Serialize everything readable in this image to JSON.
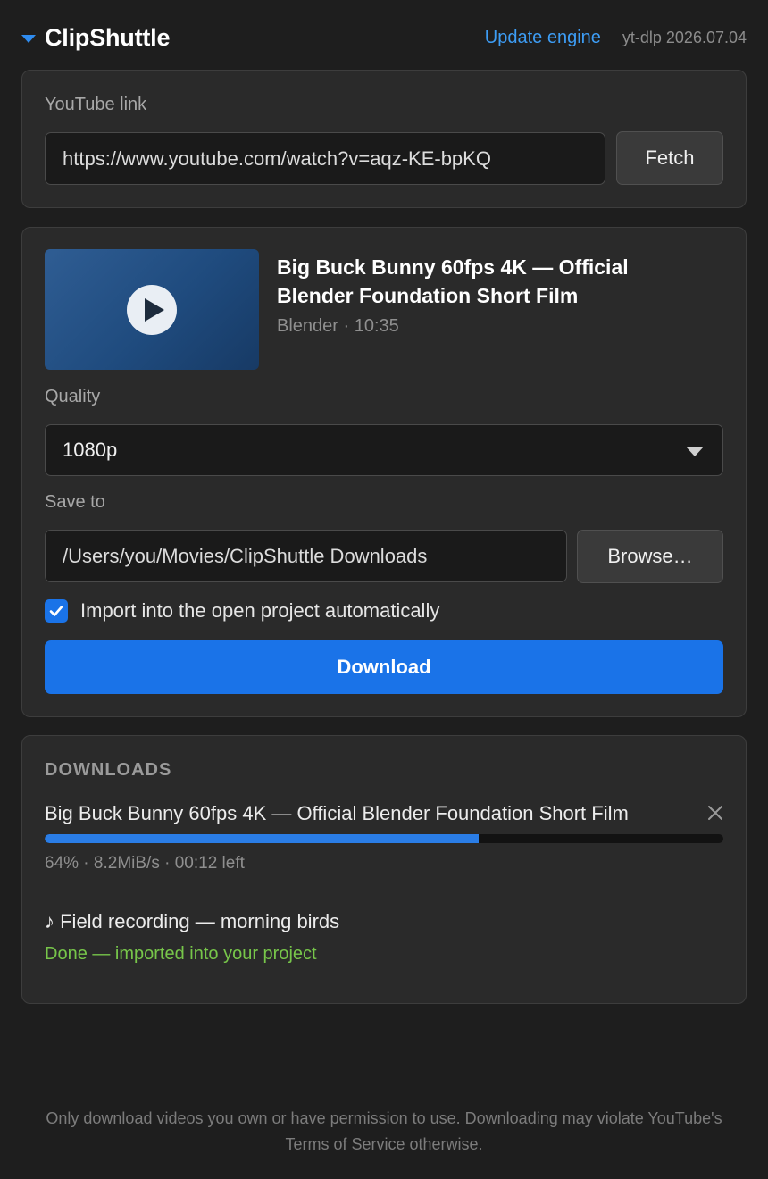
{
  "app": {
    "title": "ClipShuttle",
    "update_link": "Update engine",
    "engine_version": "yt-dlp 2026.07.04"
  },
  "link_section": {
    "label": "YouTube link",
    "url_value": "https://www.youtube.com/watch?v=aqz-KE-bpKQ",
    "fetch_label": "Fetch"
  },
  "video": {
    "title": "Big Buck Bunny 60fps 4K — Official Blender Foundation Short Film",
    "meta": "Blender · 10:35",
    "thumbnail_icon": "play-icon",
    "quality_label": "Quality",
    "quality_value": "1080p",
    "save_label": "Save to",
    "save_path": "/Users/you/Movies/ClipShuttle Downloads",
    "browse_label": "Browse…",
    "import_checkbox_label": "Import into the open project automatically",
    "import_checked": true,
    "download_label": "Download"
  },
  "downloads": {
    "heading": "DOWNLOADS",
    "items": [
      {
        "title": "Big Buck Bunny 60fps 4K — Official Blender Foundation Short Film",
        "progress": 0.64,
        "stats": "64% · 8.2MiB/s · 00:12 left",
        "status": "in-progress"
      },
      {
        "title": "♪ Field recording — morning birds",
        "status_text": "Done — imported into your project",
        "status": "done"
      }
    ]
  },
  "footer": {
    "disclaimer": "Only download videos you own or have permission to use. Downloading may violate YouTube's Terms of Service otherwise."
  },
  "colors": {
    "accent": "#1a73e8",
    "link": "#3d9df5",
    "success": "#77c64a",
    "background": "#1e1e1e",
    "panel": "#2a2a2a"
  }
}
